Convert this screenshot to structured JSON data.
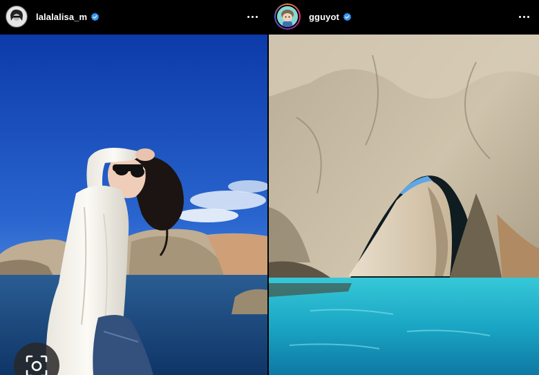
{
  "posts": [
    {
      "username": "lalalalisa_m",
      "verified": true,
      "avatar_icon": "profile-photo",
      "photo": "woman-in-sunglasses-on-boat"
    },
    {
      "username": "gguyot",
      "verified": true,
      "avatar_icon": "cartoon-avatar",
      "photo": "sea-cave-arch-turquoise-water"
    }
  ],
  "overlay": {
    "lens_icon": "visual-search-icon"
  },
  "colors": {
    "verified": "#3897f0",
    "sky_top": "#0f3fb0",
    "sky_bottom": "#6fa6e6",
    "sea_left": "#1d4f86",
    "sea_right": "#21b6d0",
    "rock": "#c7b79a"
  }
}
